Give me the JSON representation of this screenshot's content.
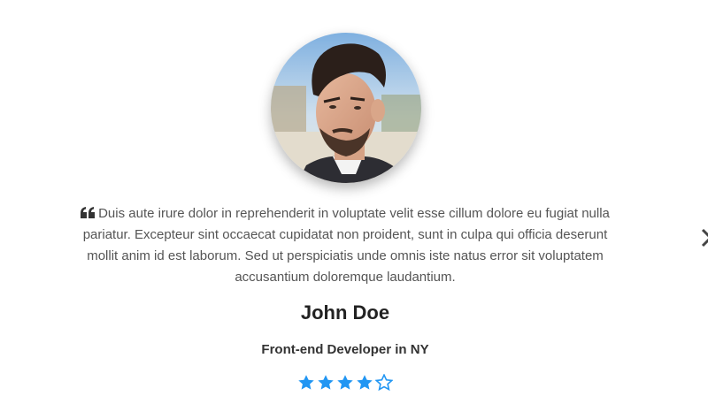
{
  "testimonial": {
    "quote": "Duis aute irure dolor in reprehenderit in voluptate velit esse cillum dolore eu fugiat nulla pariatur. Excepteur sint occaecat cupidatat non proident, sunt in culpa qui officia deserunt mollit anim id est laborum. Sed ut perspiciatis unde omnis iste natus error sit voluptatem accusantium doloremque laudantium.",
    "name": "John Doe",
    "role": "Front-end Developer in NY",
    "rating": 4,
    "rating_max": 5
  },
  "icons": {
    "quote": "quote-left-icon",
    "star_filled": "star-icon",
    "star_empty": "star-outline-icon",
    "next": "chevron-right-icon"
  },
  "colors": {
    "star": "#2196f3",
    "name": "#222222",
    "text": "#555555"
  }
}
